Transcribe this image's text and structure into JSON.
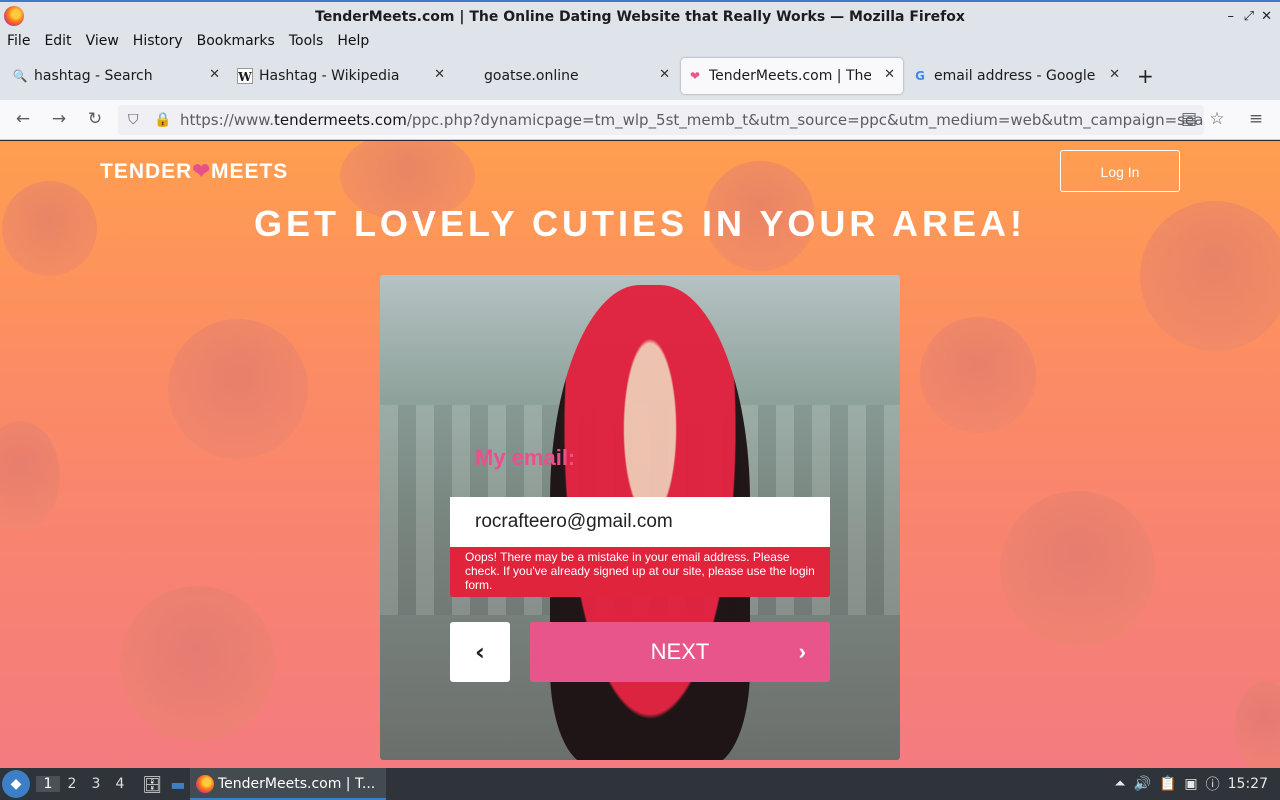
{
  "window": {
    "title": "TenderMeets.com | The Online Dating Website that Really Works — Mozilla Firefox",
    "controls": [
      "–",
      "⤢",
      "✕"
    ]
  },
  "menu": [
    "File",
    "Edit",
    "View",
    "History",
    "Bookmarks",
    "Tools",
    "Help"
  ],
  "tabs": [
    {
      "label": "hashtag - Search",
      "icon": "search-icon"
    },
    {
      "label": "Hashtag - Wikipedia",
      "icon": "wikipedia-icon"
    },
    {
      "label": "goatse.online",
      "icon": "none"
    },
    {
      "label": "TenderMeets.com | The O",
      "icon": "tendermeets-icon"
    },
    {
      "label": "email address - Google S",
      "icon": "google-icon"
    }
  ],
  "address": {
    "prefix": "https://www.",
    "host": "tendermeets.com",
    "path": "/ppc.php?dynamicpage=tm_wlp_5st_memb_t&utm_source=ppc&utm_medium=web&utm_campaign=search&"
  },
  "page": {
    "logo_left": "TENDER",
    "logo_right": "MEETS",
    "login": "Log In",
    "headline": "GET LOVELY CUTIES IN YOUR AREA!",
    "email_label": "My email:",
    "email_value": "rocrafteero@gmail.com",
    "error": "Oops! There may be a mistake in your email address. Please check. If you've already signed up at our site, please use the login form.",
    "back": "‹",
    "next": "NEXT",
    "next_chevron": "›"
  },
  "taskbar": {
    "workspaces": [
      "1",
      "2",
      "3",
      "4"
    ],
    "task": "TenderMeets.com | T...",
    "clock": "15:27"
  }
}
